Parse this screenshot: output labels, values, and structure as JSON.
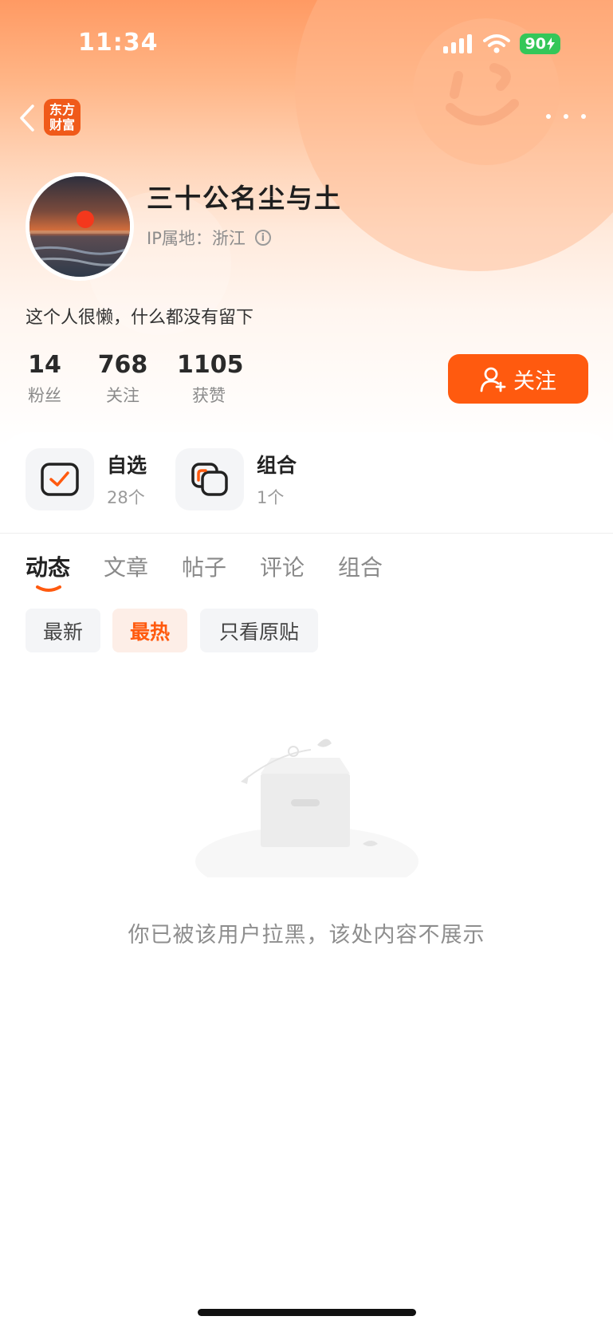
{
  "status_bar": {
    "time": "11:34",
    "battery": "90"
  },
  "header": {
    "logo_line1": "东方",
    "logo_line2": "财富"
  },
  "profile": {
    "username": "三十公名尘与土",
    "ip_label": "IP属地：浙江",
    "bio": "这个人很懒，什么都没有留下"
  },
  "stats": [
    {
      "value": "14",
      "label": "粉丝"
    },
    {
      "value": "768",
      "label": "关注"
    },
    {
      "value": "1105",
      "label": "获赞"
    }
  ],
  "follow_button": {
    "label": "关注"
  },
  "shortcuts": [
    {
      "title": "自选",
      "count": "28个",
      "icon": "watchlist-check-icon"
    },
    {
      "title": "组合",
      "count": "1个",
      "icon": "portfolio-stack-icon"
    }
  ],
  "tabs": [
    "动态",
    "文章",
    "帖子",
    "评论",
    "组合"
  ],
  "filters": [
    "最新",
    "最热",
    "只看原贴"
  ],
  "empty_state": {
    "message": "你已被该用户拉黑，该处内容不展示"
  },
  "colors": {
    "accent": "#ff5a0f",
    "hero_top": "#ff9a63",
    "chip_bg": "#f4f5f7"
  }
}
